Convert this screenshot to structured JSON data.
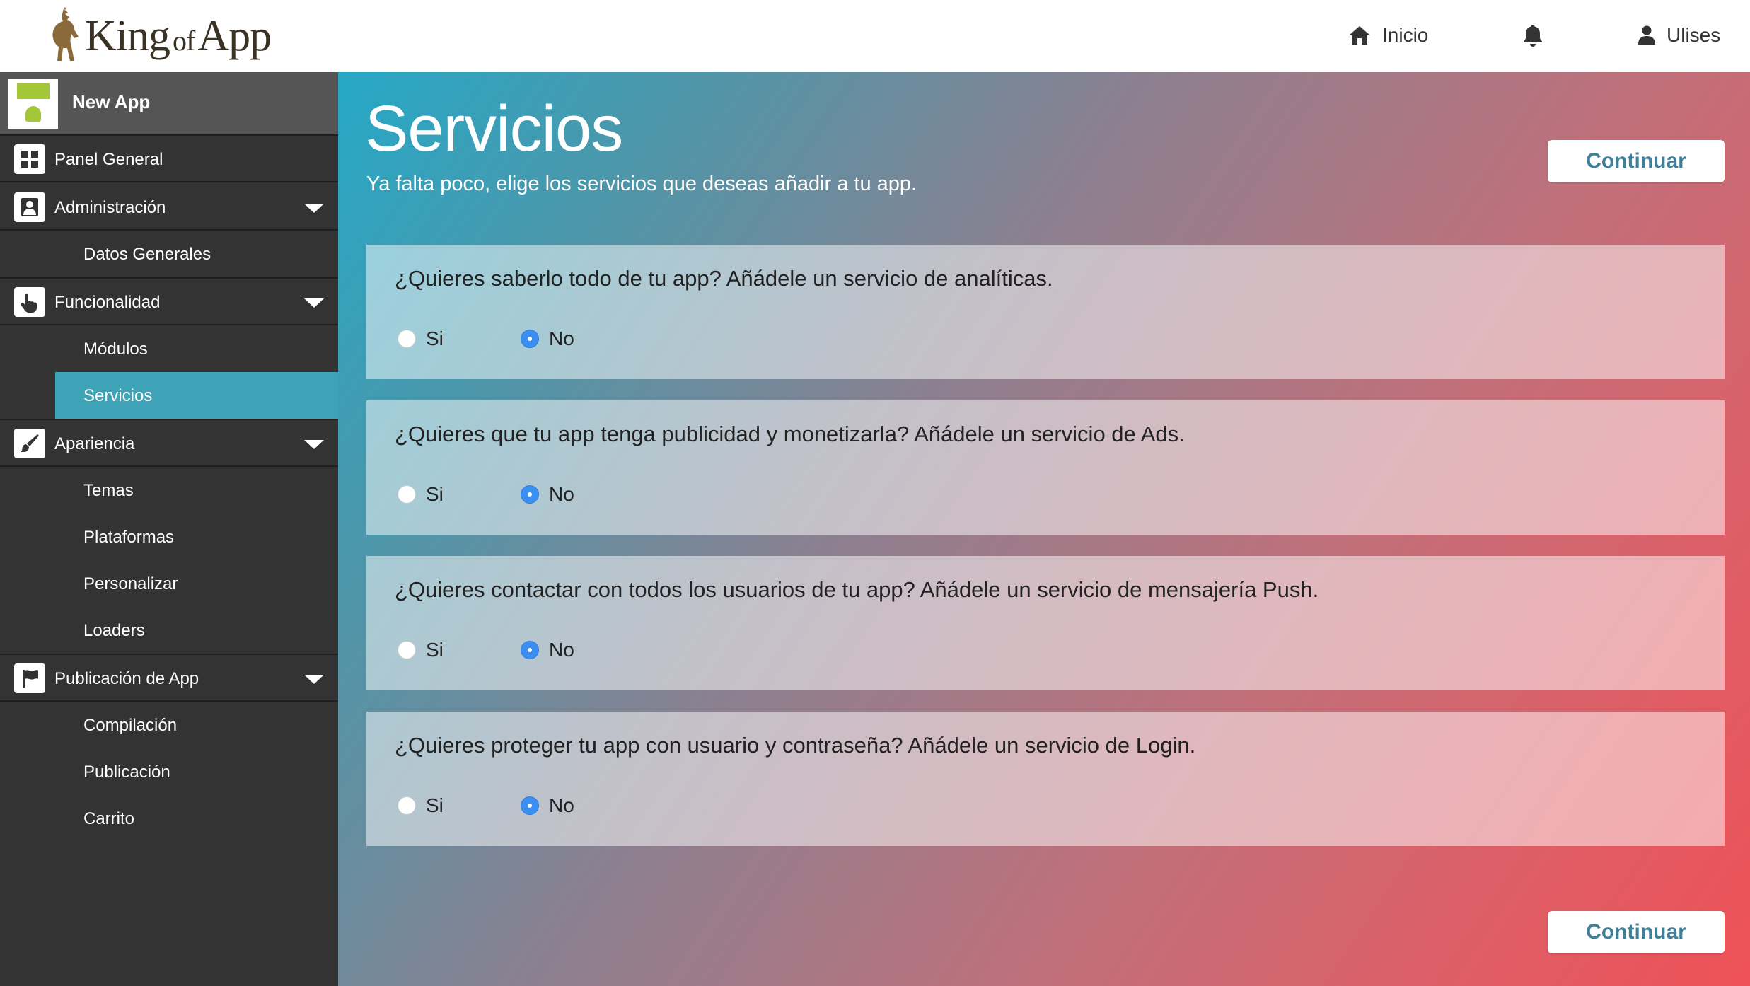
{
  "header": {
    "logo_text_king": "King",
    "logo_text_of": "of",
    "logo_text_app": "App",
    "nav": {
      "home_label": "Inicio",
      "user_label": "Ulises"
    },
    "icons": [
      "home-icon",
      "bell-icon",
      "user-icon"
    ]
  },
  "sidebar": {
    "app_name": "New App",
    "sections": {
      "panel": {
        "label": "Panel General",
        "icon": "dashboard-icon"
      },
      "admin": {
        "label": "Administración",
        "icon": "user-icon",
        "items": [
          "Datos Generales"
        ]
      },
      "func": {
        "label": "Funcionalidad",
        "icon": "pointer-hand-icon",
        "items": [
          "Módulos",
          "Servicios"
        ]
      },
      "appearance": {
        "label": "Apariencia",
        "icon": "brush-icon",
        "items": [
          "Temas",
          "Plataformas",
          "Personalizar",
          "Loaders"
        ]
      },
      "publish": {
        "label": "Publicación de App",
        "icon": "flag-icon",
        "items": [
          "Compilación",
          "Publicación",
          "Carrito"
        ]
      }
    },
    "active_item": "Servicios"
  },
  "main": {
    "title": "Servicios",
    "subtitle": "Ya falta poco, elige los servicios que deseas añadir a tu app.",
    "continue_label": "Continuar",
    "radio_yes": "Si",
    "radio_no": "No",
    "services": [
      {
        "question": "¿Quieres saberlo todo de tu app? Añádele un servicio de analíticas.",
        "selected": "No"
      },
      {
        "question": "¿Quieres que tu app tenga publicidad y monetizarla? Añádele un servicio de Ads.",
        "selected": "No"
      },
      {
        "question": "¿Quieres contactar con todos los usuarios de tu app? Añádele un servicio de mensajería Push.",
        "selected": "No"
      },
      {
        "question": "¿Quieres proteger tu app con usuario y contraseña? Añádele un servicio de Login.",
        "selected": "No"
      }
    ]
  },
  "colors": {
    "sidebar_bg": "#333333",
    "active_item": "#3fa3b8",
    "gradient_start": "#25a8c6",
    "gradient_end": "#ee5157",
    "button_text": "#3f7f98",
    "radio_checked": "#3b8ff0"
  }
}
